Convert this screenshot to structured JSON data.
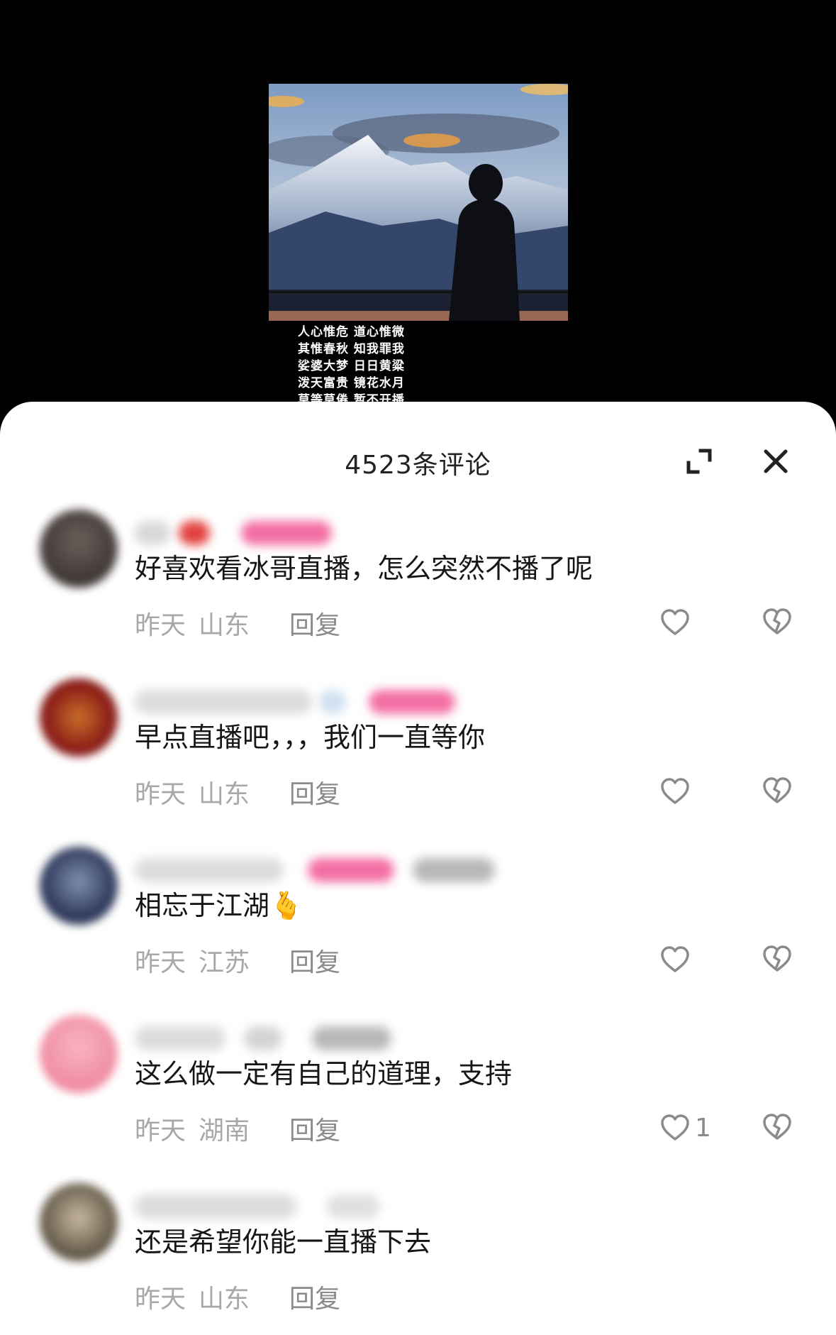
{
  "video": {
    "poem_lines": [
      "人心惟危 道心惟微",
      "其惟春秋 知我罪我",
      "娑婆大梦 日日黄粱",
      "泼天富贵 镜花水月",
      "莫等莫倦 暂不开播"
    ]
  },
  "sheet": {
    "title": "4523条评论",
    "icons": {
      "expand": "expand-icon",
      "close": "close-icon"
    }
  },
  "comments": [
    {
      "text": "好喜欢看冰哥直播，怎么突然不播了呢",
      "time": "昨天",
      "location": "山东",
      "reply_label": "回复",
      "likes": ""
    },
    {
      "text": "早点直播吧，，，我们一直等你",
      "time": "昨天",
      "location": "山东",
      "reply_label": "回复",
      "likes": ""
    },
    {
      "text": "相忘于江湖🫰",
      "time": "昨天",
      "location": "江苏",
      "reply_label": "回复",
      "likes": ""
    },
    {
      "text": "这么做一定有自己的道理，支持",
      "time": "昨天",
      "location": "湖南",
      "reply_label": "回复",
      "likes": "1"
    },
    {
      "text": "还是希望你能一直播下去",
      "time": "昨天",
      "location": "山东",
      "reply_label": "回复",
      "likes": ""
    }
  ],
  "colors": {
    "sheet_bg": "#ffffff",
    "text_primary": "#161616",
    "text_secondary": "#a8a8a8",
    "icon_gray": "#8a8a8a"
  }
}
